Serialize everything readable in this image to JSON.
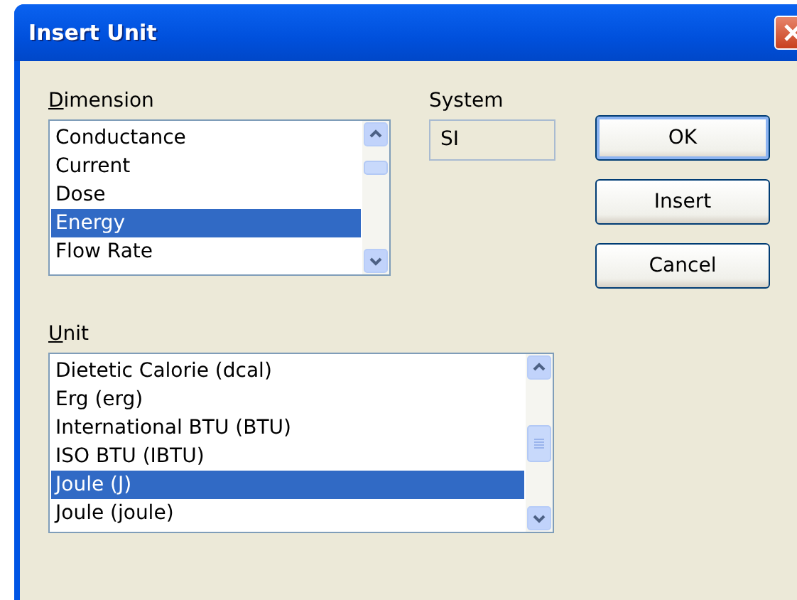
{
  "window": {
    "title": "Insert Unit"
  },
  "dimension": {
    "label": "Dimension",
    "items": [
      {
        "label": "Conductance",
        "selected": false
      },
      {
        "label": "Current",
        "selected": false
      },
      {
        "label": "Dose",
        "selected": false
      },
      {
        "label": "Energy",
        "selected": true
      },
      {
        "label": "Flow Rate",
        "selected": false
      }
    ]
  },
  "system": {
    "label": "System",
    "value": "SI"
  },
  "buttons": [
    {
      "label": "OK",
      "default": true
    },
    {
      "label": "Insert",
      "default": false
    },
    {
      "label": "Cancel",
      "default": false
    }
  ],
  "unit": {
    "label": "Unit",
    "items": [
      {
        "label": "Dietetic Calorie (dcal)",
        "selected": false
      },
      {
        "label": "Erg (erg)",
        "selected": false
      },
      {
        "label": "International BTU (BTU)",
        "selected": false
      },
      {
        "label": "ISO BTU (IBTU)",
        "selected": false
      },
      {
        "label": "Joule (J)",
        "selected": true
      },
      {
        "label": "Joule (joule)",
        "selected": false
      }
    ]
  }
}
